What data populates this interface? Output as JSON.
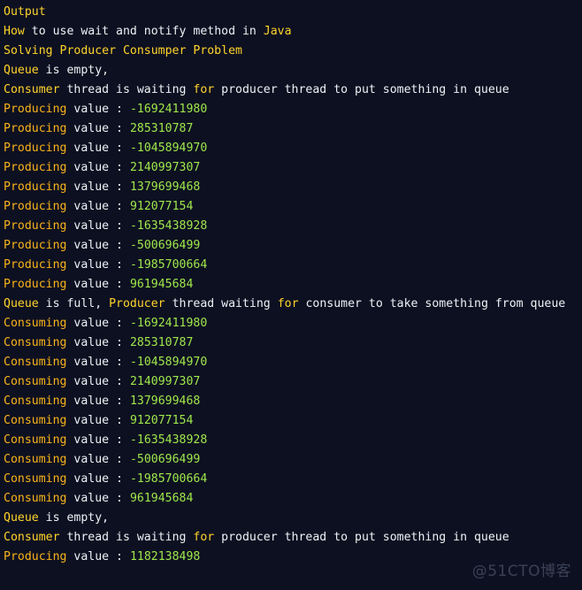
{
  "console": {
    "title": "Output",
    "background_color": "#0d1021",
    "colors": {
      "yellow": "#ffd42a",
      "orange": "#f9b41a",
      "white": "#eef1f5",
      "green": "#9fe84b"
    },
    "lines": [
      {
        "id": "line-output-title",
        "segments": [
          {
            "text": "Output",
            "color": "yellow"
          }
        ]
      },
      {
        "id": "line-heading-1",
        "segments": [
          {
            "text": "How",
            "color": "yellow"
          },
          {
            "text": " to use wait and notify method in ",
            "color": "white"
          },
          {
            "text": "Java",
            "color": "yellow"
          }
        ]
      },
      {
        "id": "line-heading-2",
        "segments": [
          {
            "text": "Solving Producer Consumper Problem",
            "color": "yellow"
          }
        ]
      },
      {
        "id": "line-queue-empty-1",
        "segments": [
          {
            "text": "Queue",
            "color": "yellow"
          },
          {
            "text": " is empty,",
            "color": "white"
          },
          {
            "text": "Consumer",
            "color": "yellow"
          },
          {
            "text": " thread is waiting ",
            "color": "white"
          },
          {
            "text": "for",
            "color": "yellow"
          },
          {
            "text": " producer thread to put something in queue",
            "color": "white"
          }
        ]
      },
      {
        "id": "line-producing-1",
        "segments": [
          {
            "text": "Producing",
            "color": "orange"
          },
          {
            "text": " value",
            "color": "white"
          },
          {
            "text": " : ",
            "color": "white"
          },
          {
            "text": "-1692411980",
            "color": "green"
          }
        ]
      },
      {
        "id": "line-producing-2",
        "segments": [
          {
            "text": "Producing",
            "color": "orange"
          },
          {
            "text": " value",
            "color": "white"
          },
          {
            "text": " : ",
            "color": "white"
          },
          {
            "text": "285310787",
            "color": "green"
          }
        ]
      },
      {
        "id": "line-producing-3",
        "segments": [
          {
            "text": "Producing",
            "color": "orange"
          },
          {
            "text": " value",
            "color": "white"
          },
          {
            "text": " : ",
            "color": "white"
          },
          {
            "text": "-1045894970",
            "color": "green"
          }
        ]
      },
      {
        "id": "line-producing-4",
        "segments": [
          {
            "text": "Producing",
            "color": "orange"
          },
          {
            "text": " value",
            "color": "white"
          },
          {
            "text": " : ",
            "color": "white"
          },
          {
            "text": "2140997307",
            "color": "green"
          }
        ]
      },
      {
        "id": "line-producing-5",
        "segments": [
          {
            "text": "Producing",
            "color": "orange"
          },
          {
            "text": " value",
            "color": "white"
          },
          {
            "text": " : ",
            "color": "white"
          },
          {
            "text": "1379699468",
            "color": "green"
          }
        ]
      },
      {
        "id": "line-producing-6",
        "segments": [
          {
            "text": "Producing",
            "color": "orange"
          },
          {
            "text": " value",
            "color": "white"
          },
          {
            "text": " : ",
            "color": "white"
          },
          {
            "text": "912077154",
            "color": "green"
          }
        ]
      },
      {
        "id": "line-producing-7",
        "segments": [
          {
            "text": "Producing",
            "color": "orange"
          },
          {
            "text": " value",
            "color": "white"
          },
          {
            "text": " : ",
            "color": "white"
          },
          {
            "text": "-1635438928",
            "color": "green"
          }
        ]
      },
      {
        "id": "line-producing-8",
        "segments": [
          {
            "text": "Producing",
            "color": "orange"
          },
          {
            "text": " value",
            "color": "white"
          },
          {
            "text": " : ",
            "color": "white"
          },
          {
            "text": "-500696499",
            "color": "green"
          }
        ]
      },
      {
        "id": "line-producing-9",
        "segments": [
          {
            "text": "Producing",
            "color": "orange"
          },
          {
            "text": " value",
            "color": "white"
          },
          {
            "text": " : ",
            "color": "white"
          },
          {
            "text": "-1985700664",
            "color": "green"
          }
        ]
      },
      {
        "id": "line-producing-10",
        "segments": [
          {
            "text": "Producing",
            "color": "orange"
          },
          {
            "text": " value",
            "color": "white"
          },
          {
            "text": " : ",
            "color": "white"
          },
          {
            "text": "961945684",
            "color": "green"
          }
        ]
      },
      {
        "id": "line-queue-full",
        "segments": [
          {
            "text": "Queue",
            "color": "yellow"
          },
          {
            "text": " is full, ",
            "color": "white"
          },
          {
            "text": "Producer",
            "color": "yellow"
          },
          {
            "text": " thread waiting ",
            "color": "white"
          },
          {
            "text": "for",
            "color": "yellow"
          },
          {
            "text": " consumer to take something from queue",
            "color": "white"
          }
        ]
      },
      {
        "id": "line-consuming-1",
        "segments": [
          {
            "text": "Consuming",
            "color": "orange"
          },
          {
            "text": " value",
            "color": "white"
          },
          {
            "text": " : ",
            "color": "white"
          },
          {
            "text": "-1692411980",
            "color": "green"
          }
        ]
      },
      {
        "id": "line-consuming-2",
        "segments": [
          {
            "text": "Consuming",
            "color": "orange"
          },
          {
            "text": " value",
            "color": "white"
          },
          {
            "text": " : ",
            "color": "white"
          },
          {
            "text": "285310787",
            "color": "green"
          }
        ]
      },
      {
        "id": "line-consuming-3",
        "segments": [
          {
            "text": "Consuming",
            "color": "orange"
          },
          {
            "text": " value",
            "color": "white"
          },
          {
            "text": " : ",
            "color": "white"
          },
          {
            "text": "-1045894970",
            "color": "green"
          }
        ]
      },
      {
        "id": "line-consuming-4",
        "segments": [
          {
            "text": "Consuming",
            "color": "orange"
          },
          {
            "text": " value",
            "color": "white"
          },
          {
            "text": " : ",
            "color": "white"
          },
          {
            "text": "2140997307",
            "color": "green"
          }
        ]
      },
      {
        "id": "line-consuming-5",
        "segments": [
          {
            "text": "Consuming",
            "color": "orange"
          },
          {
            "text": " value",
            "color": "white"
          },
          {
            "text": " : ",
            "color": "white"
          },
          {
            "text": "1379699468",
            "color": "green"
          }
        ]
      },
      {
        "id": "line-consuming-6",
        "segments": [
          {
            "text": "Consuming",
            "color": "orange"
          },
          {
            "text": " value",
            "color": "white"
          },
          {
            "text": " : ",
            "color": "white"
          },
          {
            "text": "912077154",
            "color": "green"
          }
        ]
      },
      {
        "id": "line-consuming-7",
        "segments": [
          {
            "text": "Consuming",
            "color": "orange"
          },
          {
            "text": " value",
            "color": "white"
          },
          {
            "text": " : ",
            "color": "white"
          },
          {
            "text": "-1635438928",
            "color": "green"
          }
        ]
      },
      {
        "id": "line-consuming-8",
        "segments": [
          {
            "text": "Consuming",
            "color": "orange"
          },
          {
            "text": " value",
            "color": "white"
          },
          {
            "text": " : ",
            "color": "white"
          },
          {
            "text": "-500696499",
            "color": "green"
          }
        ]
      },
      {
        "id": "line-consuming-9",
        "segments": [
          {
            "text": "Consuming",
            "color": "orange"
          },
          {
            "text": " value",
            "color": "white"
          },
          {
            "text": " : ",
            "color": "white"
          },
          {
            "text": "-1985700664",
            "color": "green"
          }
        ]
      },
      {
        "id": "line-consuming-10",
        "segments": [
          {
            "text": "Consuming",
            "color": "orange"
          },
          {
            "text": " value",
            "color": "white"
          },
          {
            "text": " : ",
            "color": "white"
          },
          {
            "text": "961945684",
            "color": "green"
          }
        ]
      },
      {
        "id": "line-queue-empty-2",
        "segments": [
          {
            "text": "Queue",
            "color": "yellow"
          },
          {
            "text": " is empty,",
            "color": "white"
          },
          {
            "text": "Consumer",
            "color": "yellow"
          },
          {
            "text": " thread is waiting ",
            "color": "white"
          },
          {
            "text": "for",
            "color": "yellow"
          },
          {
            "text": " producer thread to put something in queue",
            "color": "white"
          }
        ]
      },
      {
        "id": "line-producing-11",
        "segments": [
          {
            "text": "Producing",
            "color": "orange"
          },
          {
            "text": " value",
            "color": "white"
          },
          {
            "text": " : ",
            "color": "white"
          },
          {
            "text": "1182138498",
            "color": "green"
          }
        ]
      }
    ]
  },
  "watermark": {
    "text": "@51CTO博客",
    "color": "#3b4155"
  }
}
